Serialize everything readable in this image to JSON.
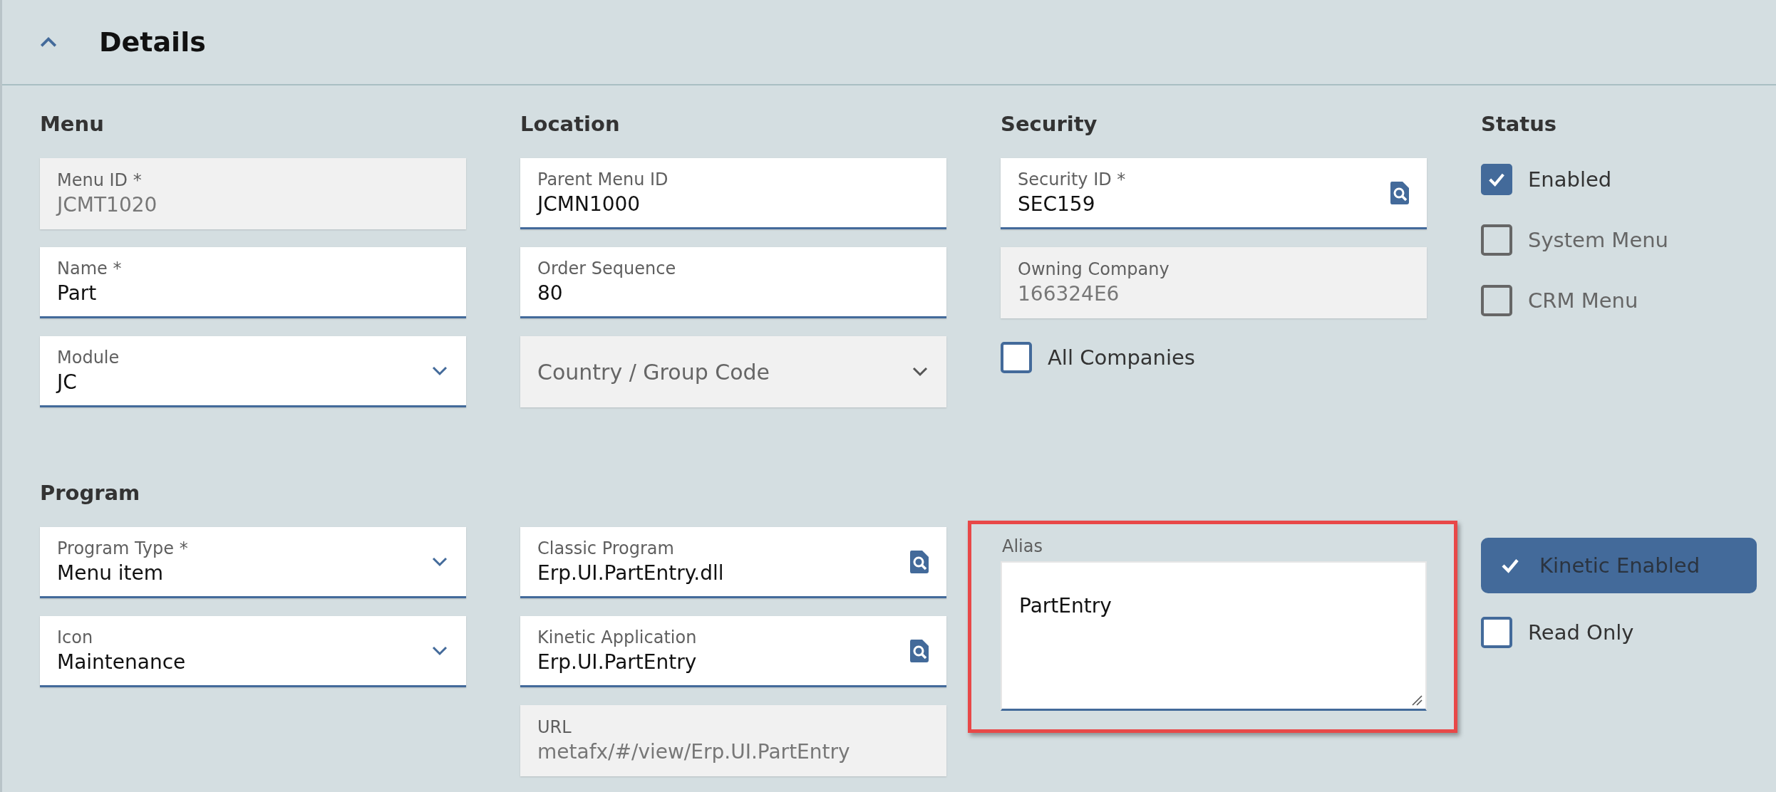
{
  "header": {
    "title": "Details",
    "expanded": true
  },
  "groups": [
    {
      "columns": [
        {
          "heading": "Menu",
          "items": [
            {
              "kind": "text",
              "label": "Menu ID *",
              "value": "JCMT1020",
              "disabled": true
            },
            {
              "kind": "text",
              "label": "Name *",
              "value": "Part",
              "disabled": false
            },
            {
              "kind": "select",
              "label": "Module",
              "value": "JC",
              "disabled": false
            }
          ]
        },
        {
          "heading": "Location",
          "items": [
            {
              "kind": "text",
              "label": "Parent Menu ID",
              "value": "JCMN1000",
              "disabled": false
            },
            {
              "kind": "text",
              "label": "Order Sequence",
              "value": "80",
              "disabled": false
            },
            {
              "kind": "select",
              "placeholder": "Country / Group Code",
              "disabled": true
            }
          ]
        },
        {
          "heading": "Security",
          "items": [
            {
              "kind": "lookup",
              "label": "Security ID *",
              "value": "SEC159",
              "disabled": false
            },
            {
              "kind": "text",
              "label": "Owning Company",
              "value": "166324E6",
              "disabled": true
            },
            {
              "kind": "checkbox",
              "label": "All Companies",
              "checked": false,
              "disabled": false
            }
          ]
        },
        {
          "heading": "Status",
          "items": [
            {
              "kind": "checkbox",
              "label": "Enabled",
              "checked": true,
              "disabled": false
            },
            {
              "kind": "checkbox",
              "label": "System Menu",
              "checked": false,
              "disabled": true
            },
            {
              "kind": "checkbox",
              "label": "CRM Menu",
              "checked": false,
              "disabled": true
            }
          ]
        }
      ]
    },
    {
      "heading": "Program",
      "columns": [
        {
          "items": [
            {
              "kind": "select",
              "label": "Program Type *",
              "value": "Menu item",
              "disabled": false
            },
            {
              "kind": "select",
              "label": "Icon",
              "value": "Maintenance",
              "disabled": false
            }
          ]
        },
        {
          "items": [
            {
              "kind": "lookup",
              "label": "Classic Program",
              "value": "Erp.UI.PartEntry.dll",
              "disabled": false
            },
            {
              "kind": "lookup",
              "label": "Kinetic Application",
              "value": "Erp.UI.PartEntry",
              "disabled": false
            },
            {
              "kind": "text",
              "label": "URL",
              "value": "metafx/#/view/Erp.UI.PartEntry",
              "disabled": true
            }
          ]
        },
        {
          "items": [
            {
              "kind": "textarea",
              "label": "Alias",
              "value": "PartEntry",
              "highlighted": true
            }
          ]
        },
        {
          "items": [
            {
              "kind": "toggle",
              "label": "Kinetic Enabled",
              "selected": true
            },
            {
              "kind": "checkbox",
              "label": "Read Only",
              "checked": false,
              "disabled": false
            }
          ]
        }
      ]
    }
  ]
}
